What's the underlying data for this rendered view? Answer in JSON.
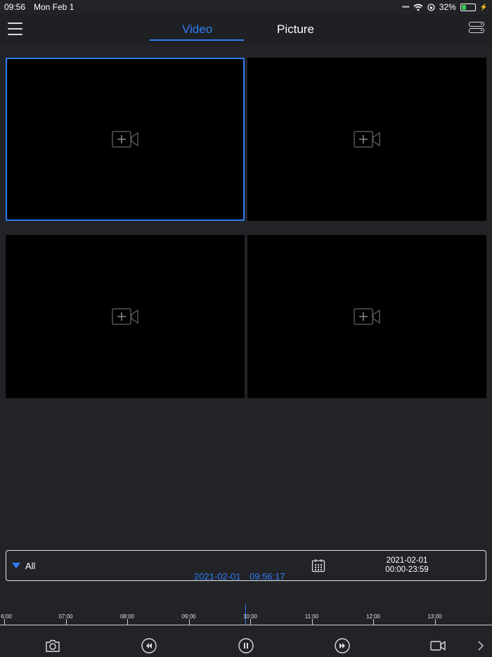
{
  "status_bar": {
    "time": "09:56",
    "date": "Mon Feb 1",
    "battery": "32%",
    "battery_level": 0.32
  },
  "nav": {
    "tabs": [
      {
        "label": "Video",
        "active": true
      },
      {
        "label": "Picture",
        "active": false
      }
    ]
  },
  "tiles": [
    {
      "selected": true
    },
    {
      "selected": false
    },
    {
      "selected": false
    },
    {
      "selected": false
    }
  ],
  "filter": {
    "label": "All",
    "date": "2021-02-01",
    "range": "00:00-23:59"
  },
  "playback": {
    "date": "2021-02-01",
    "time": "09:56:17"
  },
  "timeline": {
    "labels": [
      "6:00",
      "07:00",
      "08:00",
      "09:00",
      "10:00",
      "11:00",
      "12:00",
      "13:00"
    ]
  },
  "colors": {
    "accent": "#2f7cf6",
    "background": "#222327",
    "tile": "#000000"
  }
}
